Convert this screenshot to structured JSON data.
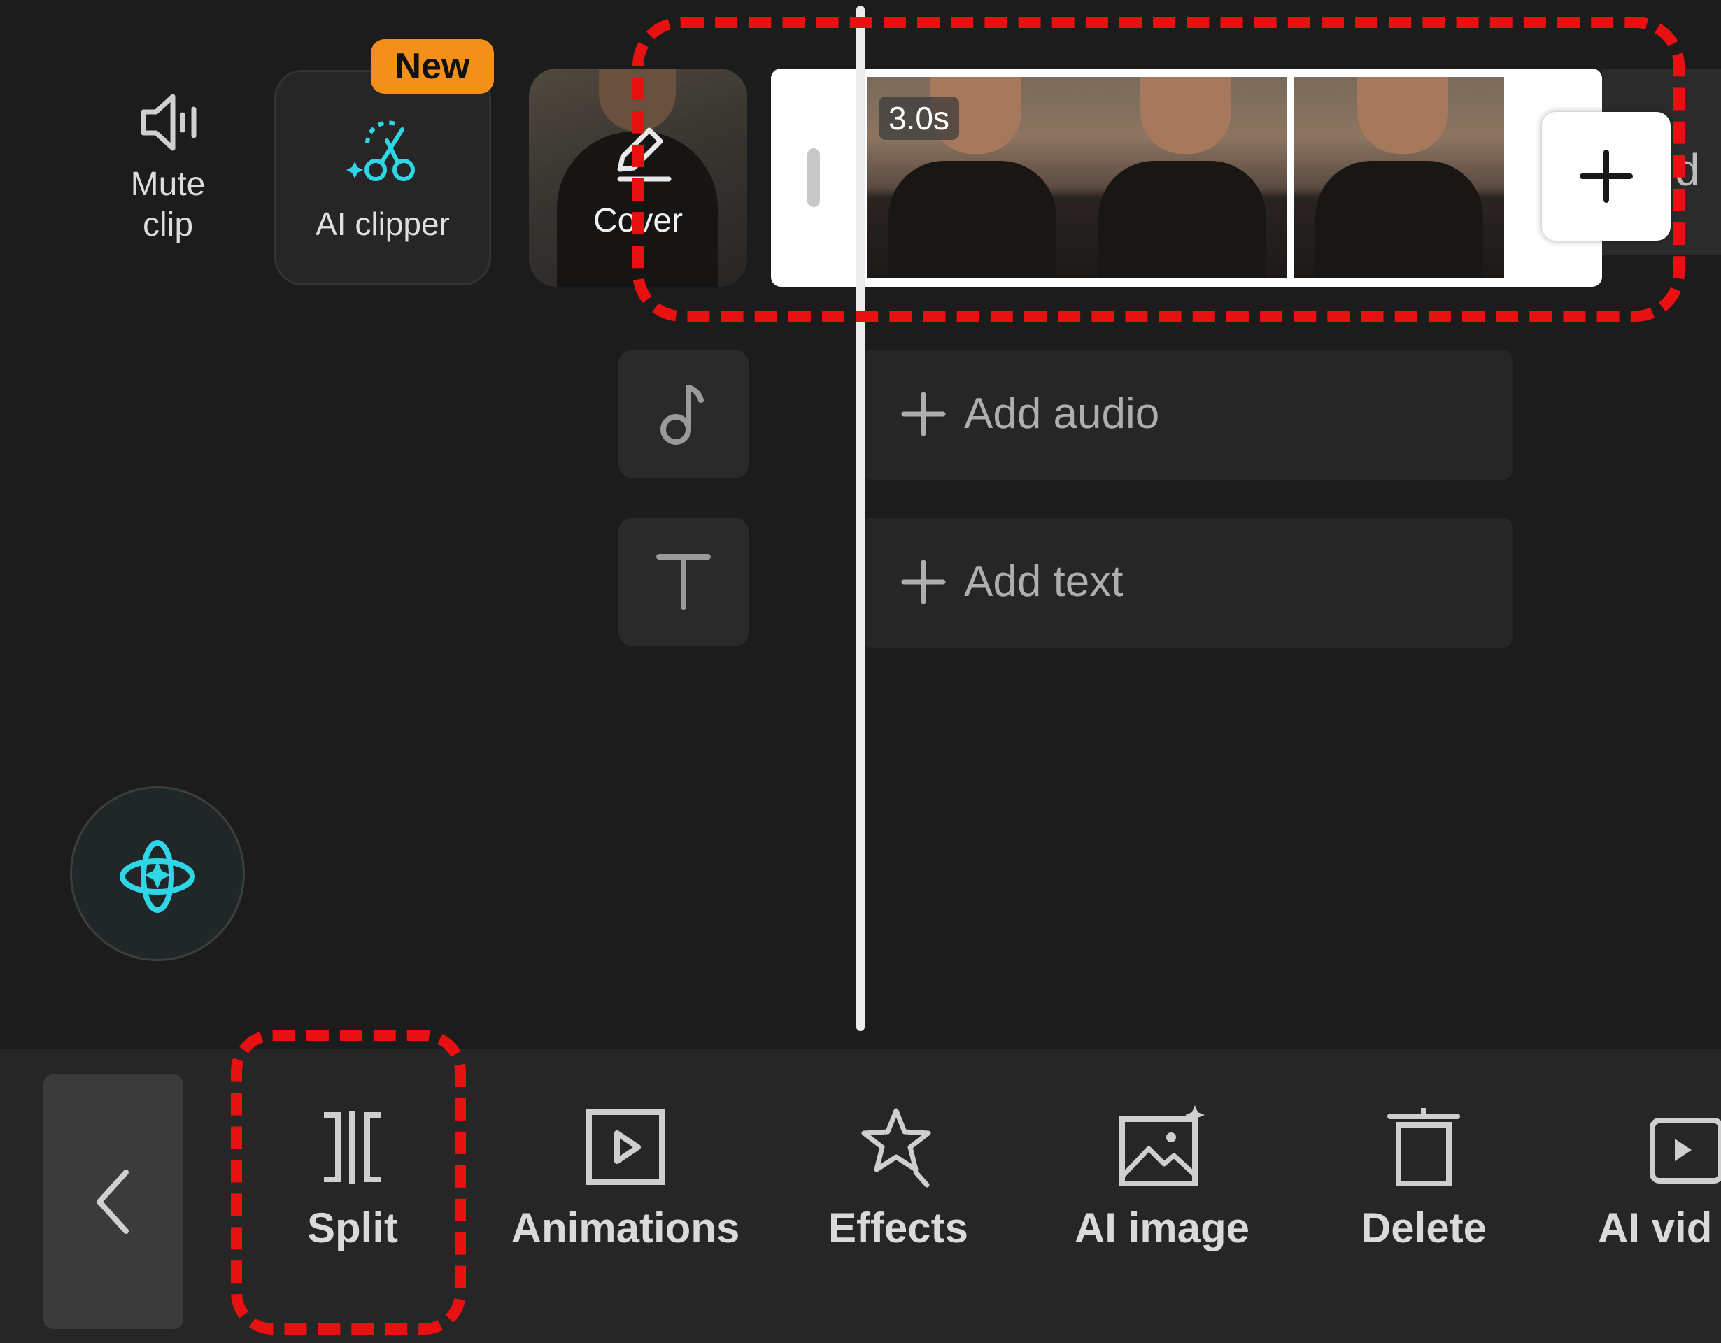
{
  "top_tools": {
    "mute_label_line1": "Mute",
    "mute_label_line2": "clip",
    "ai_clipper_label": "AI clipper",
    "new_badge": "New",
    "cover_label": "Cover"
  },
  "timeline": {
    "clip_duration": "3.0s",
    "add_audio_label": "Add audio",
    "add_text_label": "Add text",
    "partial_clip_text": "d"
  },
  "toolbar": {
    "items": [
      {
        "label": "Split",
        "icon": "split-icon"
      },
      {
        "label": "Animations",
        "icon": "animations-icon"
      },
      {
        "label": "Effects",
        "icon": "effects-icon"
      },
      {
        "label": "AI image",
        "icon": "ai-image-icon"
      },
      {
        "label": "Delete",
        "icon": "delete-icon"
      },
      {
        "label": "AI vid",
        "icon": "ai-video-icon"
      }
    ]
  },
  "colors": {
    "accent_cyan": "#2fd6e6",
    "badge_orange": "#f39019",
    "annotation_red": "#e81010"
  }
}
